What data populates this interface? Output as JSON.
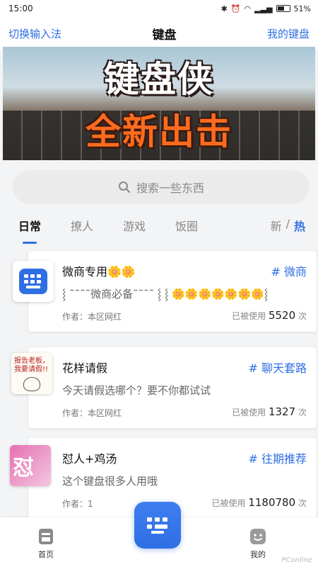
{
  "status": {
    "time": "15:00",
    "battery": "51%"
  },
  "header": {
    "left": "切换输入法",
    "title": "键盘",
    "right": "我的键盘"
  },
  "banner": {
    "line1": "键盘侠",
    "line2": "全新出击"
  },
  "search": {
    "placeholder": "搜索一些东西"
  },
  "tabs": [
    {
      "label": "日常"
    },
    {
      "label": "撩人"
    },
    {
      "label": "游戏"
    },
    {
      "label": "饭圈"
    }
  ],
  "sort": {
    "new": "新",
    "sep": "/",
    "hot": "热"
  },
  "cards": [
    {
      "name": "微商专用🌼🌼",
      "tag": "# 微商",
      "desc": "⸾ ˜˜˜˜微商必备˜˜˜˜ ⸾ ⸾ 🌼🌼🌼🌼🌼🌼🌼⸾",
      "author": "作者：本区网红",
      "usage_label": "已被使用",
      "usage_count": "5520",
      "usage_unit": "次"
    },
    {
      "name": "花样请假",
      "tag": "# 聊天套路",
      "desc": "今天请假选哪个？要不你都试试",
      "author": "作者：本区网红",
      "usage_label": "已被使用",
      "usage_count": "1327",
      "usage_unit": "次",
      "thumb_text": "报告老板，我要请假!!"
    },
    {
      "name": "怼人+鸡汤",
      "tag": "# 往期推荐",
      "desc": "这个键盘很多人用哦",
      "author": "作者：1",
      "usage_label": "已被使用",
      "usage_count": "1180780",
      "usage_unit": "次",
      "thumb_text": "怼"
    }
  ],
  "bottom_nav": {
    "home": "首页",
    "mine": "我的"
  },
  "watermark": "PConline"
}
